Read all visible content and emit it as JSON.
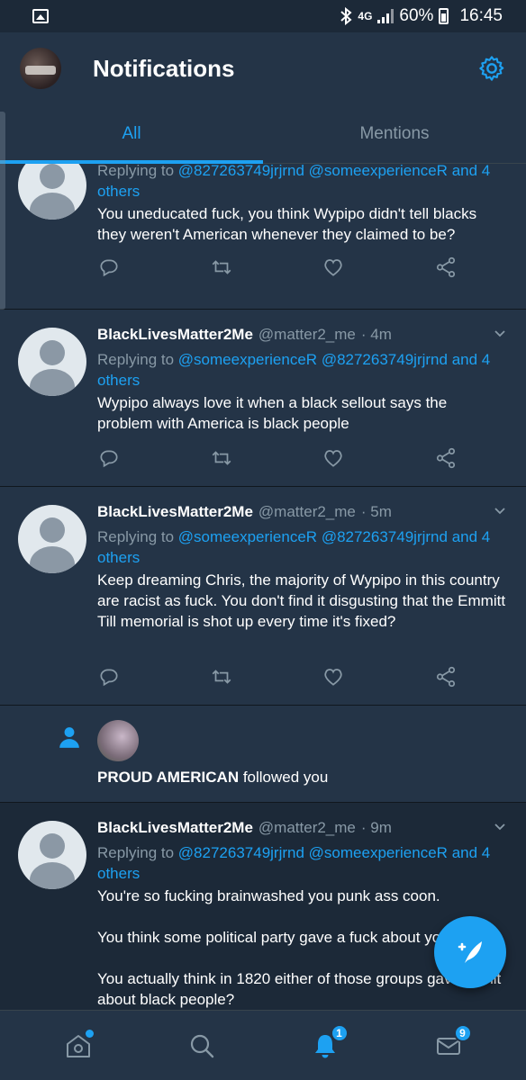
{
  "status_bar": {
    "battery": "60%",
    "time": "16:45",
    "network": "4G"
  },
  "header": {
    "title": "Notifications"
  },
  "tabs": [
    {
      "label": "All",
      "active": true
    },
    {
      "label": "Mentions",
      "active": false
    }
  ],
  "tweets": [
    {
      "name": "",
      "handle": "",
      "time": "",
      "reply_prefix": "Replying to",
      "mentions": [
        "@827263749jrjrnd",
        "@someexperienceR"
      ],
      "reply_suffix": "and",
      "others": "4 others",
      "text": [
        "You uneducated fuck, you think Wypipo didn't tell blacks they weren't American whenever they claimed to be?"
      ]
    },
    {
      "name": "BlackLivesMatter2Me",
      "handle": "@matter2_me",
      "time": "· 4m",
      "reply_prefix": "Replying to",
      "mentions": [
        "@someexperienceR",
        "@827263749jrjrnd"
      ],
      "reply_suffix": "and",
      "others": "4 others",
      "text": [
        "Wypipo always love it when a black sellout says the problem with America is black people"
      ]
    },
    {
      "name": "BlackLivesMatter2Me",
      "handle": "@matter2_me",
      "time": "· 5m",
      "reply_prefix": "Replying to",
      "mentions": [
        "@someexperienceR",
        "@827263749jrjrnd"
      ],
      "reply_suffix": "and",
      "others": "4 others",
      "text": [
        "Keep dreaming Chris, the majority of Wypipo in this country are racist as fuck. You don't find it disgusting that the Emmitt Till memorial is shot up every time it's fixed?"
      ]
    },
    {
      "name": "BlackLivesMatter2Me",
      "handle": "@matter2_me",
      "time": "· 9m",
      "reply_prefix": "Replying to",
      "mentions": [
        "@827263749jrjrnd",
        "@someexperienceR"
      ],
      "reply_suffix": "and",
      "others": "4 others",
      "text": [
        "You're so fucking brainwashed you punk ass coon.",
        "You think some political party gave a fuck about you?",
        "You actually think in 1820 either of those groups gave a shit about black people?"
      ]
    }
  ],
  "follow": {
    "name": "PROUD AMERICAN",
    "action": "followed you"
  },
  "bottom_nav": {
    "notifications_badge": "1",
    "messages_badge": "9"
  },
  "colors": {
    "background": "#243447",
    "accent": "#1da1f2",
    "muted": "#8899a6"
  },
  "icons": [
    "gallery-icon",
    "bluetooth-icon",
    "signal-icon",
    "battery-icon",
    "gear-icon",
    "reply-icon",
    "retweet-icon",
    "like-icon",
    "share-icon",
    "person-icon",
    "compose-icon",
    "home-icon",
    "search-icon",
    "bell-icon",
    "mail-icon",
    "chevron-down-icon"
  ]
}
